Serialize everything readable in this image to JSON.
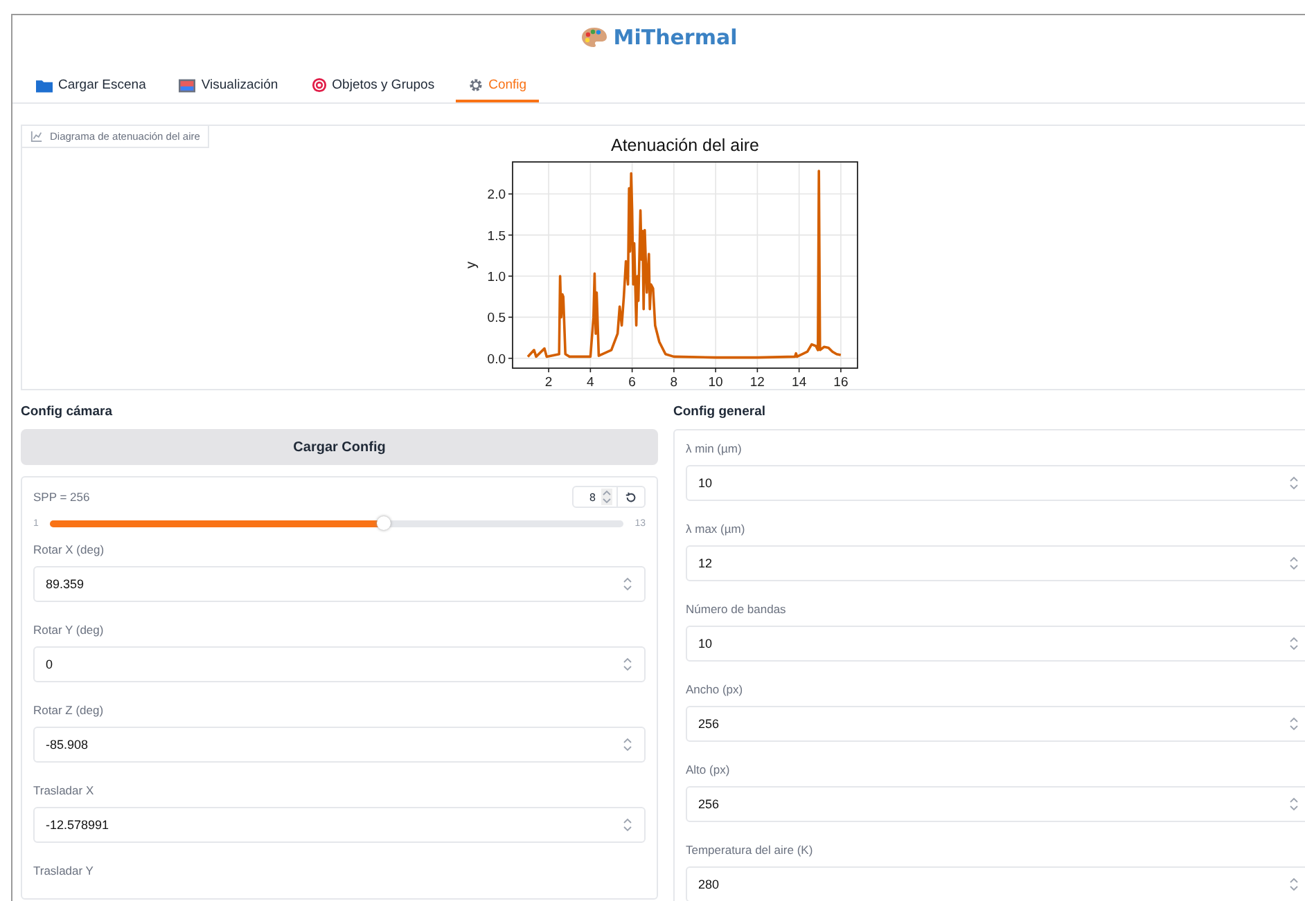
{
  "app": {
    "title": "MiThermal"
  },
  "tabs": [
    {
      "label": "Cargar Escena",
      "selected": false
    },
    {
      "label": "Visualización",
      "selected": false
    },
    {
      "label": "Objetos y Grupos",
      "selected": false
    },
    {
      "label": "Config",
      "selected": true
    }
  ],
  "chart_panel": {
    "label": "Diagrama de atenuación del aire",
    "chart_data": {
      "type": "line",
      "title": "Atenuación del aire",
      "ylabel": "y",
      "x": [
        1,
        1.3,
        1.4,
        1.8,
        1.9,
        2.5,
        2.55,
        2.6,
        2.65,
        2.7,
        2.8,
        3,
        4,
        4.15,
        4.2,
        4.25,
        4.3,
        4.4,
        5,
        5.3,
        5.4,
        5.5,
        5.6,
        5.7,
        5.8,
        5.85,
        5.9,
        5.95,
        6,
        6.05,
        6.1,
        6.2,
        6.25,
        6.3,
        6.4,
        6.45,
        6.5,
        6.55,
        6.6,
        6.7,
        6.8,
        6.85,
        6.9,
        7,
        7.1,
        7.3,
        7.6,
        8,
        10,
        12,
        13.8,
        13.85,
        13.9,
        14.4,
        14.6,
        14.8,
        14.9,
        14.95,
        15,
        15.2,
        15.4,
        15.6,
        15.8,
        16
      ],
      "series": [
        {
          "color": "#d45f00",
          "values": [
            0.02,
            0.1,
            0.02,
            0.12,
            0.02,
            0.05,
            1.0,
            0.5,
            0.78,
            0.75,
            0.05,
            0.02,
            0.02,
            0.5,
            1.03,
            0.3,
            0.8,
            0.03,
            0.1,
            0.3,
            0.63,
            0.4,
            0.75,
            1.18,
            0.9,
            2.07,
            1.3,
            2.25,
            1.8,
            0.9,
            1.4,
            0.4,
            1.0,
            0.7,
            1.8,
            1.2,
            1.55,
            0.6,
            1.56,
            0.8,
            1.27,
            0.6,
            0.9,
            0.85,
            0.4,
            0.2,
            0.05,
            0.02,
            0.01,
            0.01,
            0.02,
            0.06,
            0.02,
            0.08,
            0.17,
            0.15,
            0.1,
            2.28,
            0.1,
            0.14,
            0.13,
            0.08,
            0.05,
            0.04
          ]
        }
      ],
      "grid": true,
      "xlim": [
        0.27,
        16.8
      ],
      "ylim": [
        -0.12,
        2.39
      ],
      "xticks": [
        2,
        4,
        6,
        8,
        10,
        12,
        14,
        16
      ],
      "yticks": [
        {
          "value": 0,
          "label": "0.0"
        },
        {
          "value": 0.5,
          "label": "0.5"
        },
        {
          "value": 1,
          "label": "1.0"
        },
        {
          "value": 1.5,
          "label": "1.5"
        },
        {
          "value": 2,
          "label": "2.0"
        }
      ]
    }
  },
  "camera": {
    "heading": "Config cámara",
    "button": "Cargar Config",
    "slider": {
      "label": "SPP = 256",
      "value": "8",
      "min": "1",
      "max": "13",
      "level": 0.583
    },
    "fields": [
      {
        "label": "Rotar X (deg)",
        "value": "89.359"
      },
      {
        "label": "Rotar Y (deg)",
        "value": "0"
      },
      {
        "label": "Rotar Z (deg)",
        "value": "-85.908"
      },
      {
        "label": "Trasladar X",
        "value": "-12.578991"
      },
      {
        "label": "Trasladar Y"
      }
    ]
  },
  "general": {
    "heading": "Config general",
    "fields": [
      {
        "label": "λ min (µm)",
        "value": "10"
      },
      {
        "label": "λ max (µm)",
        "value": "12"
      },
      {
        "label": "Número de bandas",
        "value": "10"
      },
      {
        "label": "Ancho (px)",
        "value": "256"
      },
      {
        "label": "Alto (px)",
        "value": "256"
      },
      {
        "label": "Temperatura del aire (K)",
        "value": "280"
      }
    ]
  }
}
